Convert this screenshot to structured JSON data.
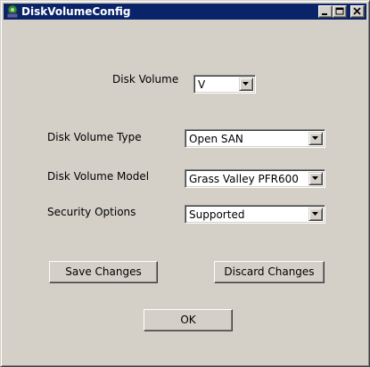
{
  "window": {
    "title": "DiskVolumeConfig"
  },
  "form": {
    "disk_volume": {
      "label": "Disk Volume",
      "value": "V"
    },
    "disk_volume_type": {
      "label": "Disk Volume Type",
      "value": "Open SAN"
    },
    "disk_volume_model": {
      "label": "Disk Volume Model",
      "value": "Grass Valley PFR600"
    },
    "security_options": {
      "label": "Security Options",
      "value": "Supported"
    }
  },
  "buttons": {
    "save": "Save Changes",
    "discard": "Discard Changes",
    "ok": "OK"
  },
  "colors": {
    "titlebar": "#0a246a",
    "face": "#d4d0c8"
  },
  "icons": {
    "app": "gear-disk-icon",
    "minimize": "minimize-icon",
    "maximize": "maximize-icon",
    "close": "close-icon",
    "dropdown": "chevron-down-icon"
  }
}
